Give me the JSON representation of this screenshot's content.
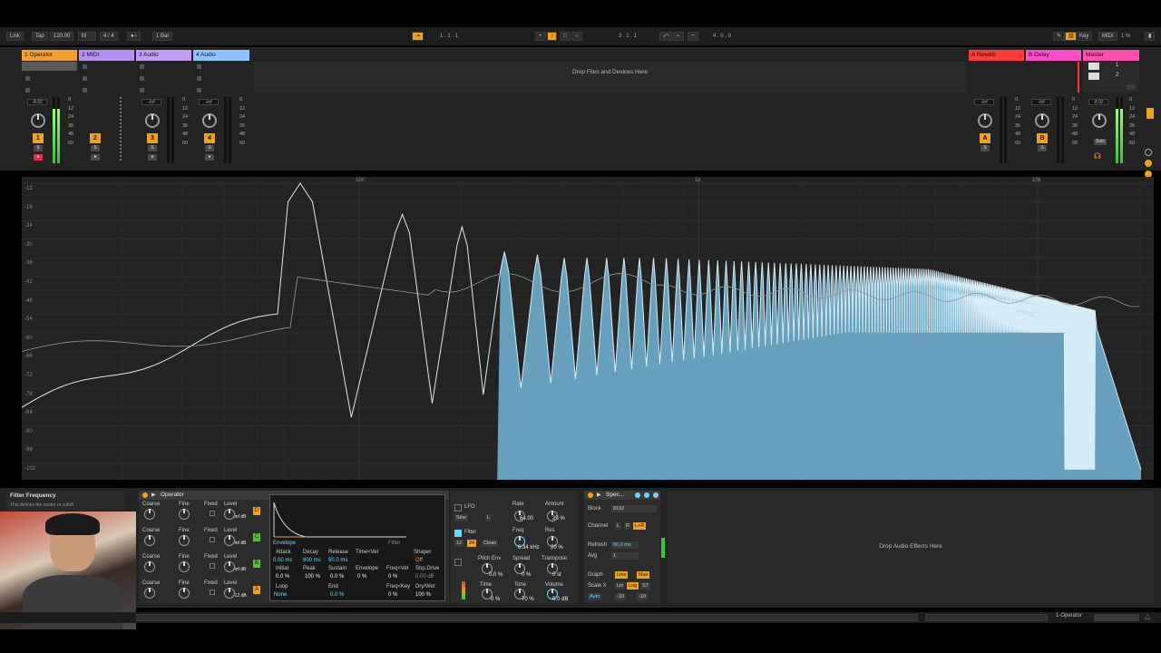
{
  "transport": {
    "link": "Link",
    "tap": "Tap",
    "tempo": "120.00",
    "signature": "4 / 4",
    "quantize": "1 Bar",
    "position": "1 . 1 . 1",
    "loop_start": "3 . 1 . 1",
    "loop_length": "4 . 0 . 0",
    "key": "Key",
    "midi": "MIDI",
    "cpu": "1 %"
  },
  "tracks": [
    {
      "name": "1 Operator",
      "color": "#f0a030",
      "number": "1",
      "vol": "-8.92"
    },
    {
      "name": "2 MIDI",
      "color": "#b692f0",
      "number": "2",
      "vol": ""
    },
    {
      "name": "3 Audio",
      "color": "#c29bf2",
      "number": "3",
      "vol": "-Inf"
    },
    {
      "name": "4 Audio",
      "color": "#8fc2ff",
      "number": "4",
      "vol": "-Inf"
    }
  ],
  "returns": [
    {
      "name": "A Reverb",
      "color": "#ff3a3a",
      "letter": "A",
      "vol": "-Inf"
    },
    {
      "name": "B Delay",
      "color": "#ff4fc8",
      "letter": "B",
      "vol": "-Inf"
    }
  ],
  "master": {
    "name": "Master",
    "color": "#ff4fb0",
    "vol": "-8.92",
    "solo": "Solo",
    "scene1": "1",
    "scene2": "2"
  },
  "drop_files": "Drop Files and Devices Here",
  "db_scale": [
    "0",
    "12",
    "24",
    "36",
    "48",
    "60"
  ],
  "spectrum": {
    "y_labels": [
      "-12",
      "-18",
      "-24",
      "-30",
      "-36",
      "-42",
      "-48",
      "-54",
      "-60",
      "-66",
      "-72",
      "-78",
      "-84",
      "-90",
      "-96",
      "-102"
    ],
    "x_labels": [
      "100",
      "1k",
      "10k"
    ]
  },
  "info": {
    "title": "Filter Frequency",
    "text": "This defines the center or cutoff"
  },
  "operator": {
    "title": "Operator",
    "osc_rows": [
      {
        "coarse": "Coarse",
        "fine": "Fine",
        "fixed": "Fixed",
        "level": "Level",
        "level_val": "-inf dB",
        "letter": "D"
      },
      {
        "coarse": "Coarse",
        "fine": "Fine",
        "fixed": "Fixed",
        "level": "Level",
        "level_val": "-inf dB",
        "letter": "C"
      },
      {
        "coarse": "Coarse",
        "fine": "Fine",
        "fixed": "Fixed",
        "level": "Level",
        "level_val": "-inf dB",
        "letter": "B"
      },
      {
        "coarse": "Coarse",
        "fine": "Fine",
        "fixed": "Fixed",
        "level": "Level",
        "level_val": "-12 dB",
        "letter": "A"
      }
    ],
    "envelope": {
      "envelope_tab": "Envelope",
      "filter_tab": "Filter",
      "attack": "Attack",
      "attack_val": "0.00 ms",
      "decay": "Decay",
      "decay_val": "600 ms",
      "release": "Release",
      "release_val": "50.0 ms",
      "timevel": "Time<Vel",
      "shaper": "Shaper",
      "shaper_val": "Off",
      "initial": "Initial",
      "initial_val": "0.0 %",
      "peak": "Peak",
      "peak_val": "100 %",
      "sustain": "Sustain",
      "sustain_val": "0.0 %",
      "envelope": "Envelope",
      "envelope_val": "0 %",
      "freqvel": "Freq<Vel",
      "freqvel_val": "0 %",
      "shpdrive": "Shp.Drive",
      "shpdrive_val": "0.00 dB",
      "loop": "Loop",
      "loop_val": "None",
      "end": "End",
      "end_val": "0.0 %",
      "freqkey": "Freq<Key",
      "freqkey_val": "0 %",
      "drywet": "Dry/Wet",
      "drywet_val": "100 %"
    },
    "lfo": {
      "lfo": "LFO",
      "wave": "Sine",
      "lr": "L",
      "rate": "Rate",
      "rate_val": "64.00",
      "amount": "Amount",
      "amount_val": "25 %",
      "filter": "Filter",
      "freq": "Freq",
      "freq_val": "6.34 kHz",
      "res": "Res",
      "res_val": "20 %",
      "slope12": "12",
      "slope24": "24",
      "clean": "Clean",
      "pitch_env": "Pitch Env",
      "spread": "Spread",
      "transpose": "Transpose",
      "pitch_val": "0.0 %",
      "spread_val": "0 %",
      "transpose_val": "0 st",
      "time": "Time",
      "tone": "Tone",
      "volume": "Volume",
      "time_val": "0 %",
      "tone_val": "70 %",
      "volume_val": "0.0 dB"
    }
  },
  "spectrum_device": {
    "title": "Spec...",
    "block": "Block",
    "block_val": "8192",
    "channel": "Channel",
    "ch_l": "L",
    "ch_r": "R",
    "ch_lr": "L+R",
    "refresh": "Refresh",
    "refresh_val": "60.0 ms",
    "avg": "Avg",
    "avg_val": "1",
    "graph": "Graph",
    "line": "Line",
    "max": "Max",
    "scalex": "Scale X",
    "lin": "Lin",
    "log": "Log",
    "st": "ST",
    "auto": "Auto",
    "range_lo": "-10",
    "range_hi": "-10"
  },
  "drop_effects": "Drop Audio Effects Here",
  "bottom": {
    "track_name": "1-Operator"
  }
}
